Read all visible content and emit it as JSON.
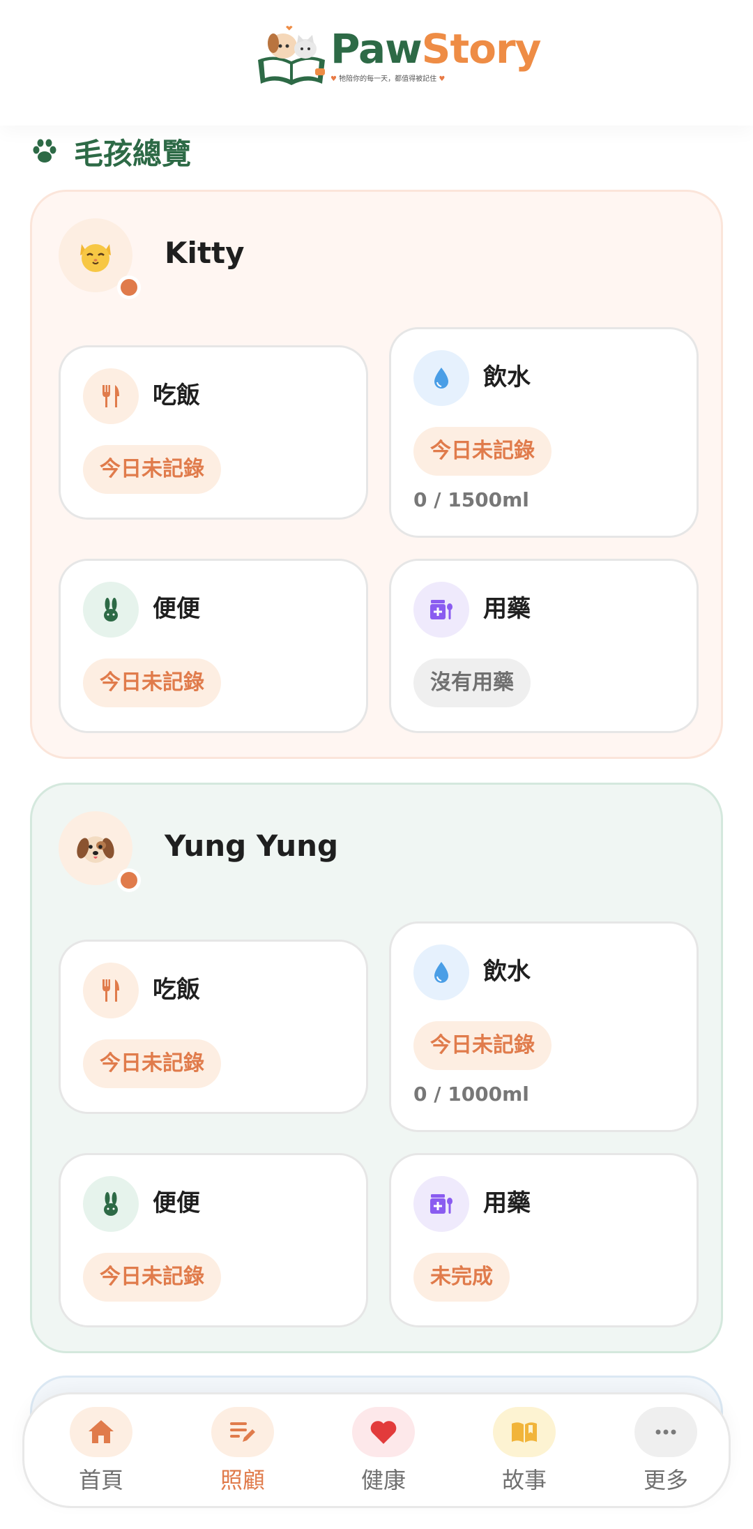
{
  "app": {
    "brand_part1": "Paw",
    "brand_part2": "Story",
    "tagline": "牠陪你的每一天，都值得被記住"
  },
  "section": {
    "title": "毛孩總覽"
  },
  "pets": [
    {
      "name": "Kitty",
      "avatar": "cat-face-icon",
      "tiles": {
        "food": {
          "label": "吃飯",
          "status": "今日未記錄"
        },
        "water": {
          "label": "飲水",
          "status": "今日未記錄",
          "progress": "0 / 1500ml"
        },
        "poop": {
          "label": "便便",
          "status": "今日未記錄"
        },
        "med": {
          "label": "用藥",
          "status": "沒有用藥"
        }
      }
    },
    {
      "name": "Yung Yung",
      "avatar": "dog-face-icon",
      "tiles": {
        "food": {
          "label": "吃飯",
          "status": "今日未記錄"
        },
        "water": {
          "label": "飲水",
          "status": "今日未記錄",
          "progress": "0 / 1000ml"
        },
        "poop": {
          "label": "便便",
          "status": "今日未記錄"
        },
        "med": {
          "label": "用藥",
          "status": "未完成"
        }
      }
    }
  ],
  "nav": {
    "items": [
      {
        "label": "首頁",
        "icon": "home-icon"
      },
      {
        "label": "照顧",
        "icon": "care-edit-icon",
        "active": true
      },
      {
        "label": "健康",
        "icon": "heart-icon"
      },
      {
        "label": "故事",
        "icon": "book-icon"
      },
      {
        "label": "更多",
        "icon": "more-icon"
      }
    ]
  },
  "colors": {
    "brand_green": "#2d6a46",
    "brand_orange": "#ee8c45",
    "accent_orange": "#e07b4b",
    "kitty_card_bg": "#fff6f2",
    "yung_card_bg": "#f0f6f3"
  }
}
